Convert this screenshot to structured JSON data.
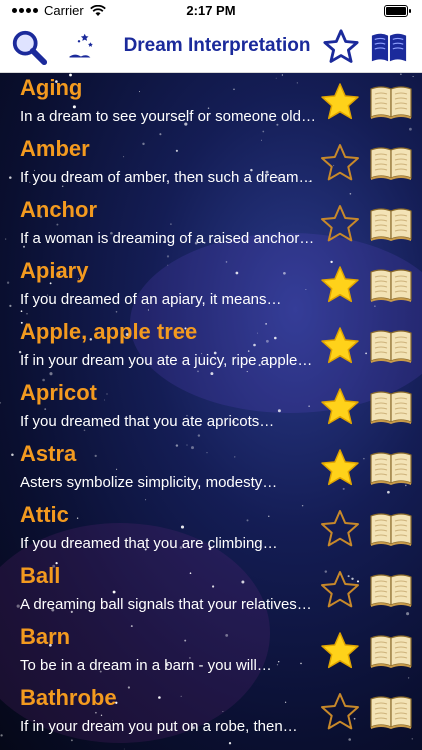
{
  "status_bar": {
    "carrier": "Carrier",
    "time": "2:17 PM"
  },
  "nav": {
    "title": "Dream Interpretation",
    "icons": [
      "search-icon",
      "moon-stars-icon",
      "star-outline-icon",
      "book-icon"
    ]
  },
  "colors": {
    "title_accent": "#1b2a9b",
    "entry_title": "#f39a1f",
    "star_fill": "#ffd21a",
    "star_outline": "#c8892a"
  },
  "entries": [
    {
      "title": "Aging",
      "desc": "In a dream to see yourself or someone old…",
      "favorite": true
    },
    {
      "title": "Amber",
      "desc": "If you dream of amber, then such a dream…",
      "favorite": false
    },
    {
      "title": "Anchor",
      "desc": "If a woman is dreaming of a raised anchor…",
      "favorite": false
    },
    {
      "title": "Apiary",
      "desc": "If you dreamed of an apiary, it means…",
      "favorite": true
    },
    {
      "title": "Apple, apple tree",
      "desc": "If in your dream you ate a juicy, ripe apple…",
      "favorite": true
    },
    {
      "title": "Apricot",
      "desc": "If you dreamed that you ate apricots…",
      "favorite": true
    },
    {
      "title": "Astra",
      "desc": "Asters symbolize simplicity, modesty…",
      "favorite": true
    },
    {
      "title": "Attic",
      "desc": "If you dreamed that you are climbing…",
      "favorite": false
    },
    {
      "title": "Ball",
      "desc": "A dreaming ball signals that your relatives…",
      "favorite": false
    },
    {
      "title": "Barn",
      "desc": "To be in a dream in a barn - you will…",
      "favorite": true
    },
    {
      "title": "Bathrobe",
      "desc": "If in your dream you put on a robe, then…",
      "favorite": false
    }
  ]
}
